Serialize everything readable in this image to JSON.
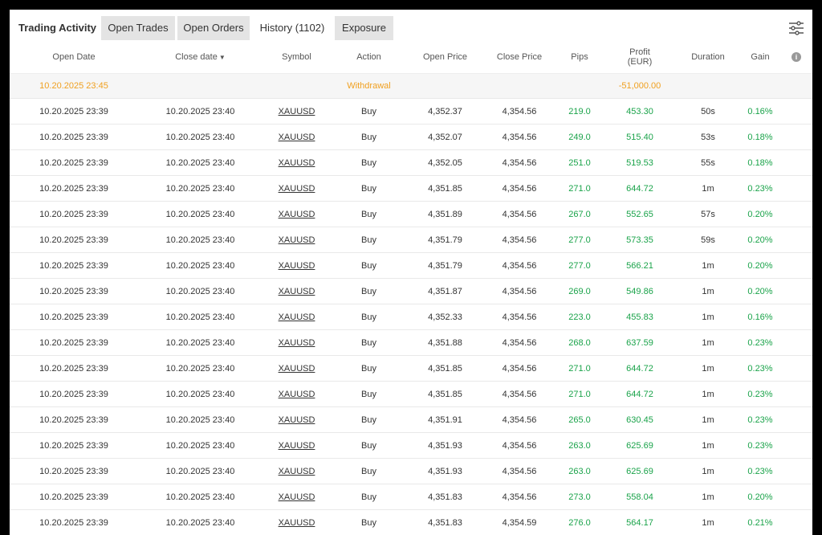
{
  "tabs": {
    "title": "Trading Activity",
    "items": [
      "Open Trades",
      "Open Orders",
      "History (1102)",
      "Exposure"
    ],
    "active": "History (1102)"
  },
  "table": {
    "headers": {
      "open_date": "Open Date",
      "close_date": "Close date",
      "sort_arrow": "▼",
      "symbol": "Symbol",
      "action": "Action",
      "open_price": "Open Price",
      "close_price": "Close Price",
      "pips": "Pips",
      "profit_line1": "Profit",
      "profit_line2": "(EUR)",
      "duration": "Duration",
      "gain": "Gain",
      "info": "i"
    },
    "withdrawal": {
      "open_date": "10.20.2025 23:45",
      "action": "Withdrawal",
      "profit": "-51,000.00"
    },
    "rows": [
      {
        "open_date": "10.20.2025 23:39",
        "close_date": "10.20.2025 23:40",
        "symbol": "XAUUSD",
        "action": "Buy",
        "open_price": "4,352.37",
        "close_price": "4,354.56",
        "pips": "219.0",
        "profit": "453.30",
        "duration": "50s",
        "gain": "0.16%"
      },
      {
        "open_date": "10.20.2025 23:39",
        "close_date": "10.20.2025 23:40",
        "symbol": "XAUUSD",
        "action": "Buy",
        "open_price": "4,352.07",
        "close_price": "4,354.56",
        "pips": "249.0",
        "profit": "515.40",
        "duration": "53s",
        "gain": "0.18%"
      },
      {
        "open_date": "10.20.2025 23:39",
        "close_date": "10.20.2025 23:40",
        "symbol": "XAUUSD",
        "action": "Buy",
        "open_price": "4,352.05",
        "close_price": "4,354.56",
        "pips": "251.0",
        "profit": "519.53",
        "duration": "55s",
        "gain": "0.18%"
      },
      {
        "open_date": "10.20.2025 23:39",
        "close_date": "10.20.2025 23:40",
        "symbol": "XAUUSD",
        "action": "Buy",
        "open_price": "4,351.85",
        "close_price": "4,354.56",
        "pips": "271.0",
        "profit": "644.72",
        "duration": "1m",
        "gain": "0.23%"
      },
      {
        "open_date": "10.20.2025 23:39",
        "close_date": "10.20.2025 23:40",
        "symbol": "XAUUSD",
        "action": "Buy",
        "open_price": "4,351.89",
        "close_price": "4,354.56",
        "pips": "267.0",
        "profit": "552.65",
        "duration": "57s",
        "gain": "0.20%"
      },
      {
        "open_date": "10.20.2025 23:39",
        "close_date": "10.20.2025 23:40",
        "symbol": "XAUUSD",
        "action": "Buy",
        "open_price": "4,351.79",
        "close_price": "4,354.56",
        "pips": "277.0",
        "profit": "573.35",
        "duration": "59s",
        "gain": "0.20%"
      },
      {
        "open_date": "10.20.2025 23:39",
        "close_date": "10.20.2025 23:40",
        "symbol": "XAUUSD",
        "action": "Buy",
        "open_price": "4,351.79",
        "close_price": "4,354.56",
        "pips": "277.0",
        "profit": "566.21",
        "duration": "1m",
        "gain": "0.20%"
      },
      {
        "open_date": "10.20.2025 23:39",
        "close_date": "10.20.2025 23:40",
        "symbol": "XAUUSD",
        "action": "Buy",
        "open_price": "4,351.87",
        "close_price": "4,354.56",
        "pips": "269.0",
        "profit": "549.86",
        "duration": "1m",
        "gain": "0.20%"
      },
      {
        "open_date": "10.20.2025 23:39",
        "close_date": "10.20.2025 23:40",
        "symbol": "XAUUSD",
        "action": "Buy",
        "open_price": "4,352.33",
        "close_price": "4,354.56",
        "pips": "223.0",
        "profit": "455.83",
        "duration": "1m",
        "gain": "0.16%"
      },
      {
        "open_date": "10.20.2025 23:39",
        "close_date": "10.20.2025 23:40",
        "symbol": "XAUUSD",
        "action": "Buy",
        "open_price": "4,351.88",
        "close_price": "4,354.56",
        "pips": "268.0",
        "profit": "637.59",
        "duration": "1m",
        "gain": "0.23%"
      },
      {
        "open_date": "10.20.2025 23:39",
        "close_date": "10.20.2025 23:40",
        "symbol": "XAUUSD",
        "action": "Buy",
        "open_price": "4,351.85",
        "close_price": "4,354.56",
        "pips": "271.0",
        "profit": "644.72",
        "duration": "1m",
        "gain": "0.23%"
      },
      {
        "open_date": "10.20.2025 23:39",
        "close_date": "10.20.2025 23:40",
        "symbol": "XAUUSD",
        "action": "Buy",
        "open_price": "4,351.85",
        "close_price": "4,354.56",
        "pips": "271.0",
        "profit": "644.72",
        "duration": "1m",
        "gain": "0.23%"
      },
      {
        "open_date": "10.20.2025 23:39",
        "close_date": "10.20.2025 23:40",
        "symbol": "XAUUSD",
        "action": "Buy",
        "open_price": "4,351.91",
        "close_price": "4,354.56",
        "pips": "265.0",
        "profit": "630.45",
        "duration": "1m",
        "gain": "0.23%"
      },
      {
        "open_date": "10.20.2025 23:39",
        "close_date": "10.20.2025 23:40",
        "symbol": "XAUUSD",
        "action": "Buy",
        "open_price": "4,351.93",
        "close_price": "4,354.56",
        "pips": "263.0",
        "profit": "625.69",
        "duration": "1m",
        "gain": "0.23%"
      },
      {
        "open_date": "10.20.2025 23:39",
        "close_date": "10.20.2025 23:40",
        "symbol": "XAUUSD",
        "action": "Buy",
        "open_price": "4,351.93",
        "close_price": "4,354.56",
        "pips": "263.0",
        "profit": "625.69",
        "duration": "1m",
        "gain": "0.23%"
      },
      {
        "open_date": "10.20.2025 23:39",
        "close_date": "10.20.2025 23:40",
        "symbol": "XAUUSD",
        "action": "Buy",
        "open_price": "4,351.83",
        "close_price": "4,354.56",
        "pips": "273.0",
        "profit": "558.04",
        "duration": "1m",
        "gain": "0.20%"
      },
      {
        "open_date": "10.20.2025 23:39",
        "close_date": "10.20.2025 23:40",
        "symbol": "XAUUSD",
        "action": "Buy",
        "open_price": "4,351.83",
        "close_price": "4,354.59",
        "pips": "276.0",
        "profit": "564.17",
        "duration": "1m",
        "gain": "0.21%"
      }
    ]
  },
  "colors": {
    "positive": "#1aa34a",
    "negative": "#e0302a",
    "withdrawal": "#f0a020",
    "tab_inactive": "#e4e4e4"
  },
  "icons": {
    "settings": "sliders-settings-icon",
    "info": "info-circle-icon"
  }
}
